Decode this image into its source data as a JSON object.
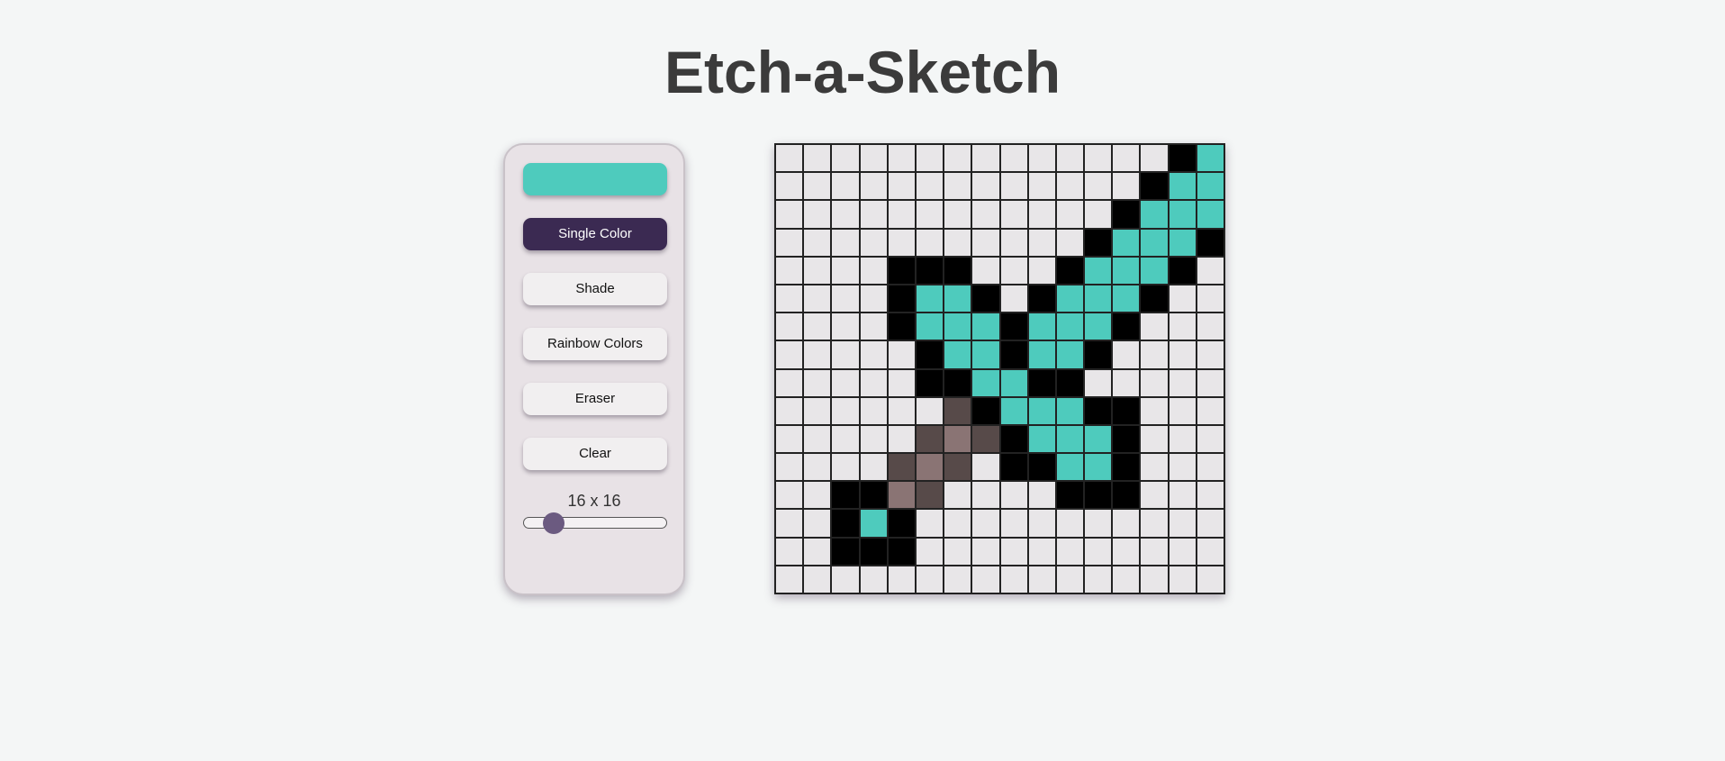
{
  "title": "Etch-a-Sketch",
  "controls": {
    "color_value": "#4ecbbd",
    "single_color_label": "Single Color",
    "shade_label": "Shade",
    "rainbow_label": "Rainbow Colors",
    "eraser_label": "Eraser",
    "clear_label": "Clear",
    "active_mode": "Single Color",
    "size_label": "16 x 16",
    "grid_size": 16,
    "slider": {
      "min": 1,
      "max": 100,
      "value": 16
    }
  },
  "colors": {
    "empty": "#e8e6e8",
    "black": "#000000",
    "teal": "#4ecbbd",
    "shade_dark": "#574a49",
    "shade_light": "#8a7474",
    "active_button": "#3b2a52",
    "slider_thumb": "#6b5a80"
  },
  "grid": {
    "legend": {
      ".": "empty",
      "B": "black",
      "T": "teal",
      "D": "shade_dark",
      "L": "shade_light"
    },
    "rows": [
      "..............BT",
      ".............BTT",
      "............BTTT",
      "...........BTTTB",
      "....BBB...BTTTB.",
      "....BTTB.BTTTB..",
      "....BTTTBTTTB...",
      ".....BTTBTTB....",
      ".....BBTTBB.....",
      "......DBTTTBB...",
      ".....DLDBTTTB...",
      "....DLD.BBTTB...",
      "..BBLD....BBB...",
      "..BTB...........",
      "..BBB...........",
      "................"
    ]
  }
}
